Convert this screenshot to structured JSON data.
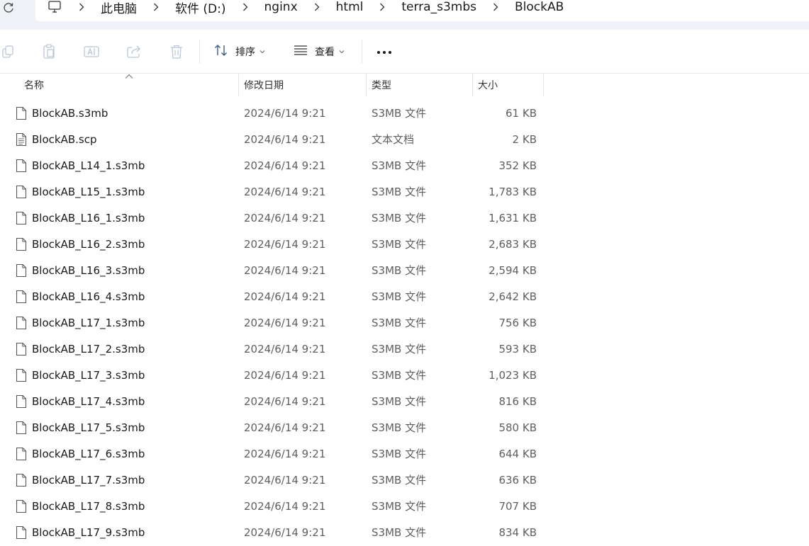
{
  "address": {
    "breadcrumbs": [
      "此电脑",
      "软件 (D:)",
      "nginx",
      "html",
      "terra_s3mbs",
      "BlockAB"
    ]
  },
  "toolbar": {
    "sort_label": "排序",
    "view_label": "查看"
  },
  "columns": {
    "name": "名称",
    "date": "修改日期",
    "type": "类型",
    "size": "大小"
  },
  "files": [
    {
      "name": "BlockAB.s3mb",
      "date": "2024/6/14 9:21",
      "type": "S3MB 文件",
      "size": "61 KB",
      "icon": "blank-file-icon"
    },
    {
      "name": "BlockAB.scp",
      "date": "2024/6/14 9:21",
      "type": "文本文档",
      "size": "2 KB",
      "icon": "text-file-icon"
    },
    {
      "name": "BlockAB_L14_1.s3mb",
      "date": "2024/6/14 9:21",
      "type": "S3MB 文件",
      "size": "352 KB",
      "icon": "blank-file-icon"
    },
    {
      "name": "BlockAB_L15_1.s3mb",
      "date": "2024/6/14 9:21",
      "type": "S3MB 文件",
      "size": "1,783 KB",
      "icon": "blank-file-icon"
    },
    {
      "name": "BlockAB_L16_1.s3mb",
      "date": "2024/6/14 9:21",
      "type": "S3MB 文件",
      "size": "1,631 KB",
      "icon": "blank-file-icon"
    },
    {
      "name": "BlockAB_L16_2.s3mb",
      "date": "2024/6/14 9:21",
      "type": "S3MB 文件",
      "size": "2,683 KB",
      "icon": "blank-file-icon"
    },
    {
      "name": "BlockAB_L16_3.s3mb",
      "date": "2024/6/14 9:21",
      "type": "S3MB 文件",
      "size": "2,594 KB",
      "icon": "blank-file-icon"
    },
    {
      "name": "BlockAB_L16_4.s3mb",
      "date": "2024/6/14 9:21",
      "type": "S3MB 文件",
      "size": "2,642 KB",
      "icon": "blank-file-icon"
    },
    {
      "name": "BlockAB_L17_1.s3mb",
      "date": "2024/6/14 9:21",
      "type": "S3MB 文件",
      "size": "756 KB",
      "icon": "blank-file-icon"
    },
    {
      "name": "BlockAB_L17_2.s3mb",
      "date": "2024/6/14 9:21",
      "type": "S3MB 文件",
      "size": "593 KB",
      "icon": "blank-file-icon"
    },
    {
      "name": "BlockAB_L17_3.s3mb",
      "date": "2024/6/14 9:21",
      "type": "S3MB 文件",
      "size": "1,023 KB",
      "icon": "blank-file-icon"
    },
    {
      "name": "BlockAB_L17_4.s3mb",
      "date": "2024/6/14 9:21",
      "type": "S3MB 文件",
      "size": "816 KB",
      "icon": "blank-file-icon"
    },
    {
      "name": "BlockAB_L17_5.s3mb",
      "date": "2024/6/14 9:21",
      "type": "S3MB 文件",
      "size": "580 KB",
      "icon": "blank-file-icon"
    },
    {
      "name": "BlockAB_L17_6.s3mb",
      "date": "2024/6/14 9:21",
      "type": "S3MB 文件",
      "size": "644 KB",
      "icon": "blank-file-icon"
    },
    {
      "name": "BlockAB_L17_7.s3mb",
      "date": "2024/6/14 9:21",
      "type": "S3MB 文件",
      "size": "636 KB",
      "icon": "blank-file-icon"
    },
    {
      "name": "BlockAB_L17_8.s3mb",
      "date": "2024/6/14 9:21",
      "type": "S3MB 文件",
      "size": "707 KB",
      "icon": "blank-file-icon"
    },
    {
      "name": "BlockAB_L17_9.s3mb",
      "date": "2024/6/14 9:21",
      "type": "S3MB 文件",
      "size": "834 KB",
      "icon": "blank-file-icon"
    }
  ]
}
